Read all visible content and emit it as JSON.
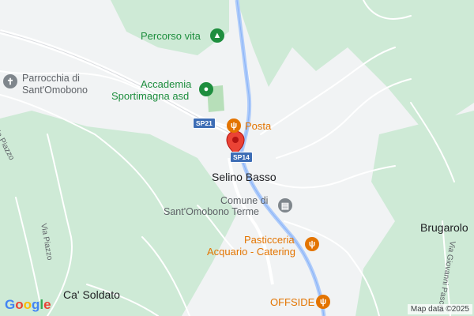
{
  "map": {
    "colors": {
      "land": "#f1f3f4",
      "forest": "#ceead6",
      "road_main": "#ffffff",
      "road_major": "#aecbfa",
      "poi_green": "#1e8e3e",
      "poi_orange": "#e37400",
      "poi_grey": "#5f6368",
      "pin": "#ea4335"
    },
    "pois": {
      "percorso": "Percorso vita",
      "chiesa_line1": "Parrocchia di",
      "chiesa_line2": "Sant'Omobono",
      "accademia_line1": "Accademia",
      "accademia_line2": "Sportimagna asd",
      "posta": "Posta",
      "comune_line1": "Comune di",
      "comune_line2": "Sant'Omobono Terme",
      "pasticceria_line1": "Pasticceria",
      "pasticceria_line2": "Acquario - Catering",
      "offside": "OFFSIDE"
    },
    "places": {
      "selino": "Selino Basso",
      "brugarolo": "Brugarolo",
      "ca_soldato": "Ca' Soldato"
    },
    "streets": {
      "via_piazzo_1": "Via Piazzo",
      "via_piazzo_2": "Via Piazzo",
      "via_giovanni": "Via Giovanni Pascoli"
    },
    "shields": {
      "sp21": "SP21",
      "sp14": "SP14"
    },
    "icons": {
      "tree": "tree-icon",
      "church": "church-icon",
      "sports": "sports-icon",
      "restaurant": "restaurant-icon",
      "townhall": "townhall-icon",
      "pin": "location-pin-icon"
    },
    "footer": {
      "logo": "Google",
      "attribution": "Map data ©2025"
    }
  }
}
